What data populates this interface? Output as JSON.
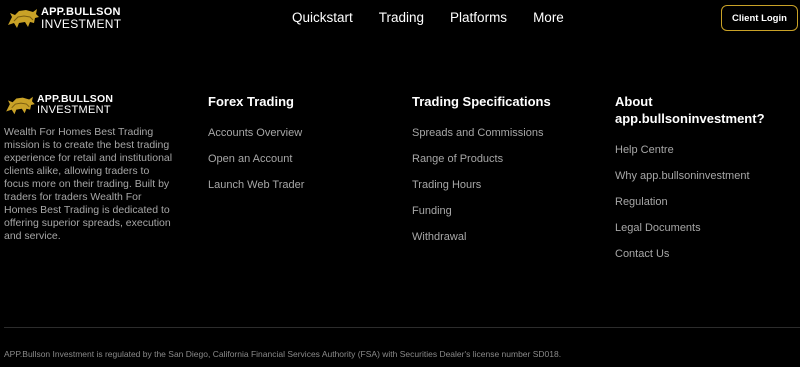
{
  "brand": {
    "name_top": "APP.BULLSON",
    "name_bottom": "INVESTMENT",
    "accent_color": "#c9a227"
  },
  "nav": {
    "items": [
      {
        "label": "Quickstart"
      },
      {
        "label": "Trading"
      },
      {
        "label": "Platforms"
      },
      {
        "label": "More"
      }
    ]
  },
  "header": {
    "client_login_label": "Client Login"
  },
  "footer": {
    "about_text": "Wealth For Homes Best Trading mission is to create the best trading experience for retail and institutional clients alike, allowing traders to focus more on their trading. Built by traders for traders Wealth For Homes Best Trading is dedicated to offering superior spreads, execution and service.",
    "forex": {
      "title": "Forex Trading",
      "links": [
        "Accounts Overview",
        "Open an Account",
        "Launch Web Trader"
      ]
    },
    "specs": {
      "title": "Trading Specifications",
      "links": [
        "Spreads and Commissions",
        "Range of Products",
        "Trading Hours",
        "Funding",
        "Withdrawal"
      ]
    },
    "about": {
      "title": "About app.bullsoninvestment?",
      "links": [
        "Help Centre",
        "Why app.bullsoninvestment",
        "Regulation",
        "Legal Documents",
        "Contact Us"
      ]
    },
    "legal": "APP.Bullson Investment is regulated by the San Diego, California Financial Services Authority (FSA) with Securities Dealer's license number SD018."
  }
}
